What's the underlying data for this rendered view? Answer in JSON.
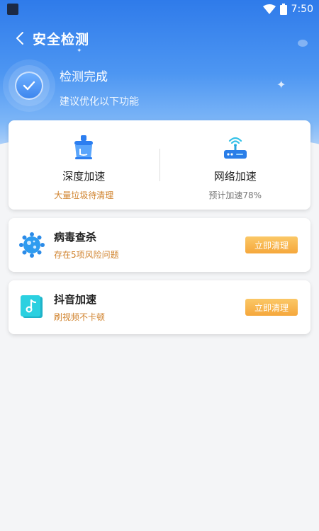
{
  "status_bar": {
    "time": "7:50"
  },
  "header": {
    "title": "安全检测"
  },
  "hero": {
    "title": "检测完成",
    "subtitle": "建议优化以下功能"
  },
  "features": [
    {
      "title": "深度加速",
      "subtitle": "大量垃圾待清理",
      "icon": "broom-icon"
    },
    {
      "title": "网络加速",
      "subtitle": "预计加速78%",
      "icon": "router-icon"
    }
  ],
  "rows": [
    {
      "title": "病毒查杀",
      "subtitle": "存在5项风险问题",
      "button": "立即清理",
      "icon": "virus-icon"
    },
    {
      "title": "抖音加速",
      "subtitle": "刷视频不卡顿",
      "button": "立即清理",
      "icon": "music-note-icon"
    }
  ],
  "colors": {
    "hero_blue": "#2f7bea",
    "accent_orange": "#f5a73b",
    "subtitle_orange": "#d0822c"
  }
}
